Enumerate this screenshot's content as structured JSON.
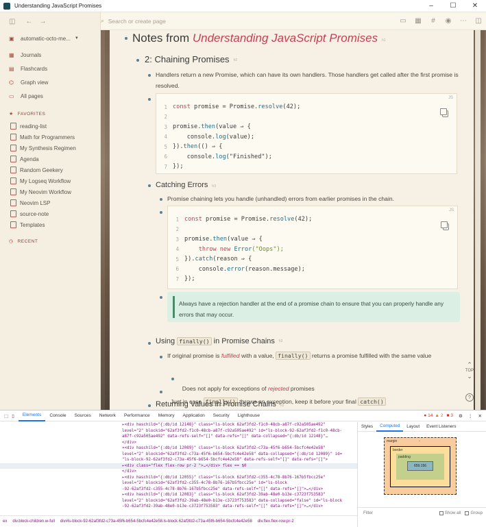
{
  "window": {
    "title": "Understanding JavaScript Promises",
    "minimize": "–",
    "maximize": "☐",
    "close": "✕"
  },
  "toolbar": {
    "search_placeholder": "Search or create page"
  },
  "sidebar": {
    "graph": "automatic-octo-me...",
    "nav": [
      {
        "label": "Journals",
        "icon": "calendar-icon",
        "glyph": "▦"
      },
      {
        "label": "Flashcards",
        "icon": "flashcards-icon",
        "glyph": "▤"
      },
      {
        "label": "Graph view",
        "icon": "graph-icon",
        "glyph": "⌬"
      },
      {
        "label": "All pages",
        "icon": "pages-icon",
        "glyph": "▭"
      }
    ],
    "favorites_title": "FAVORITES",
    "favorites": [
      "reading-list",
      "Math for Programmers",
      "My Synthesis Regimen",
      "Agenda",
      "Random Geekery",
      "My Logseq Workflow",
      "My Neovim Workflow",
      "Neovim LSP",
      "source-note",
      "Templates"
    ],
    "recent_title": "RECENT"
  },
  "page": {
    "title_prefix": "Notes from ",
    "title_em": "Understanding JavaScript Promises",
    "h2_chaining": "2: Chaining Promises",
    "chaining_text": "Handlers return a new Promise, which can have its own handlers. Those handlers get called after the first promise is resolved.",
    "lang": "JS",
    "code1": [
      [
        "const",
        " promise = Promise.",
        "resolve",
        "(42);"
      ],
      [],
      [
        "",
        "promise.",
        "then",
        "(value ⇒ {"
      ],
      [
        "",
        "    console.",
        "log",
        "(value);"
      ],
      [
        "",
        "}).",
        "then",
        "(() ⇒ {"
      ],
      [
        "",
        "    console.",
        "log",
        "(\"Finished\");"
      ],
      [
        "",
        "});",
        "",
        ""
      ]
    ],
    "h3_catching": "Catching Errors",
    "catching_text": "Promise chaining lets you handle (unhandled) errors from earlier promises in the chain.",
    "code2": [
      [
        "const",
        " promise = Promise.",
        "resolve",
        "(42);"
      ],
      [],
      [
        "",
        "promise.",
        "then",
        "(value ⇒ {"
      ],
      [
        "    throw new ",
        "Error",
        "(\"Oops\");",
        ""
      ],
      [
        "",
        "}).",
        "catch",
        "(reason ⇒ {"
      ],
      [
        "",
        "    console.",
        "error",
        "(reason.message);"
      ],
      [
        "",
        "});",
        "",
        ""
      ]
    ],
    "note": "Always have a rejection handler at the end of a promise chain to ensure that you can properly handle any errors that may occur.",
    "h3_finally_pre": "Using ",
    "h3_finally_code": "finally()",
    "h3_finally_post": " in Promise Chains",
    "f1_pre": "If original promise is ",
    "f1_em": "fulfilled",
    "f1_mid": " with a value, ",
    "f1_code": "finally()",
    "f1_post": " returns a promise fulfilled with the same value",
    "f2_pre": "Does not apply for exceptions of ",
    "f2_em": "rejected",
    "f2_post": " promises",
    "f3_pre": "Just in case ",
    "f3_code": "finally()",
    "f3_mid": " throws an exception, keep it before your final ",
    "f3_code2": "catch()",
    "h3_returning": "Returning Values in Promise Chains",
    "top_label": "TOP",
    "help": "?"
  },
  "devtools": {
    "tabs": [
      "Elements",
      "Console",
      "Sources",
      "Network",
      "Performance",
      "Memory",
      "Application",
      "Security",
      "Lighthouse"
    ],
    "badges": {
      "errors": "14",
      "warnings": "2",
      "issues": "3"
    },
    "right_tabs": [
      "Styles",
      "Computed",
      "Layout",
      "Event Listeners"
    ],
    "box": {
      "margin": "margin",
      "border": "border",
      "padding": "padding",
      "content": "659.156",
      "dash": "-"
    },
    "filter": "Filter",
    "show_all": "Show all",
    "group": "Group",
    "lines": [
      "▸<div haschild=\"{:db/id 12148}\" class=\"ls-block 62af3fd2-f1c0-48cb-a87f-c92a505ae492\"",
      "level=\"2\" blockid=\"62af3fd2-f1c0-48cb-a87f-c92a505ae492\" id=\"ls-block-92-62af3fd2-f1c0-48cb-",
      "a87f-c92a505ae492\" data-refs-self=\"[]\" data-refs=\"[]\" data-collapsed=\"{:db/id 12148}\"…",
      "</div>",
      "▾<div haschild=\"{:db/id 12089}\" class=\"ls-block 62af3fd2-c73a-45f6-b654-5bcfc4e42e58\"",
      "level=\"2\" blockid=\"62af3fd2-c73a-45f6-b654-5bcfc4e42e58\" data-collapsed=\"{:db/id 12089}\" id=",
      "\"ls-block-92-62af3fd2-c73a-45f6-b654-5bcfc4e42e58\" data-refs-self=\"[]\" data-refs=\"[]\">",
      "  ▸<div class=\"flex flex-row pr-2 \">…</div> flex == $0",
      "  </div>",
      "▸<div haschild=\"{:db/id 12055}\" class=\"ls-block 62af3fd2-c355-4c78-8b76-167b5fbcc25e\"",
      "level=\"2\" blockid=\"62af3fd2-c355-4c78-8b76-167b5fbcc25e\" id=\"ls-block",
      "-92-62af3fd2-c355-4c78-8b76-167b5fbcc25e\" data-refs-self=\"[]\" data-refs=\"[]\">…</div>",
      "▸<div haschild=\"{:db/id 12083}\" class=\"ls-block 62af3fd2-39ab-48e0-b13e-c3723f753583\"",
      "level=\"2\" blockid=\"62af3fd2-39ab-48e0-b13e-c3723f753583\" data-collapsed=\"false\" id=\"ls-block",
      "-92-62af3fd2-39ab-48e0-b13e-c3723f753583\" data-refs-self=\"[]\" data-refs=\"[]\">…</div>"
    ],
    "crumbs": [
      "ex",
      "div.block-children.w-full",
      "div#ls-block-92-62af3fd2-c73a-45f6-b654-5bcfc4e42e58.ls-block.62af3fd2-c73a-45f6-b654-5bcfc4e42e58",
      "div.flex.flex-row.pr-2"
    ]
  }
}
